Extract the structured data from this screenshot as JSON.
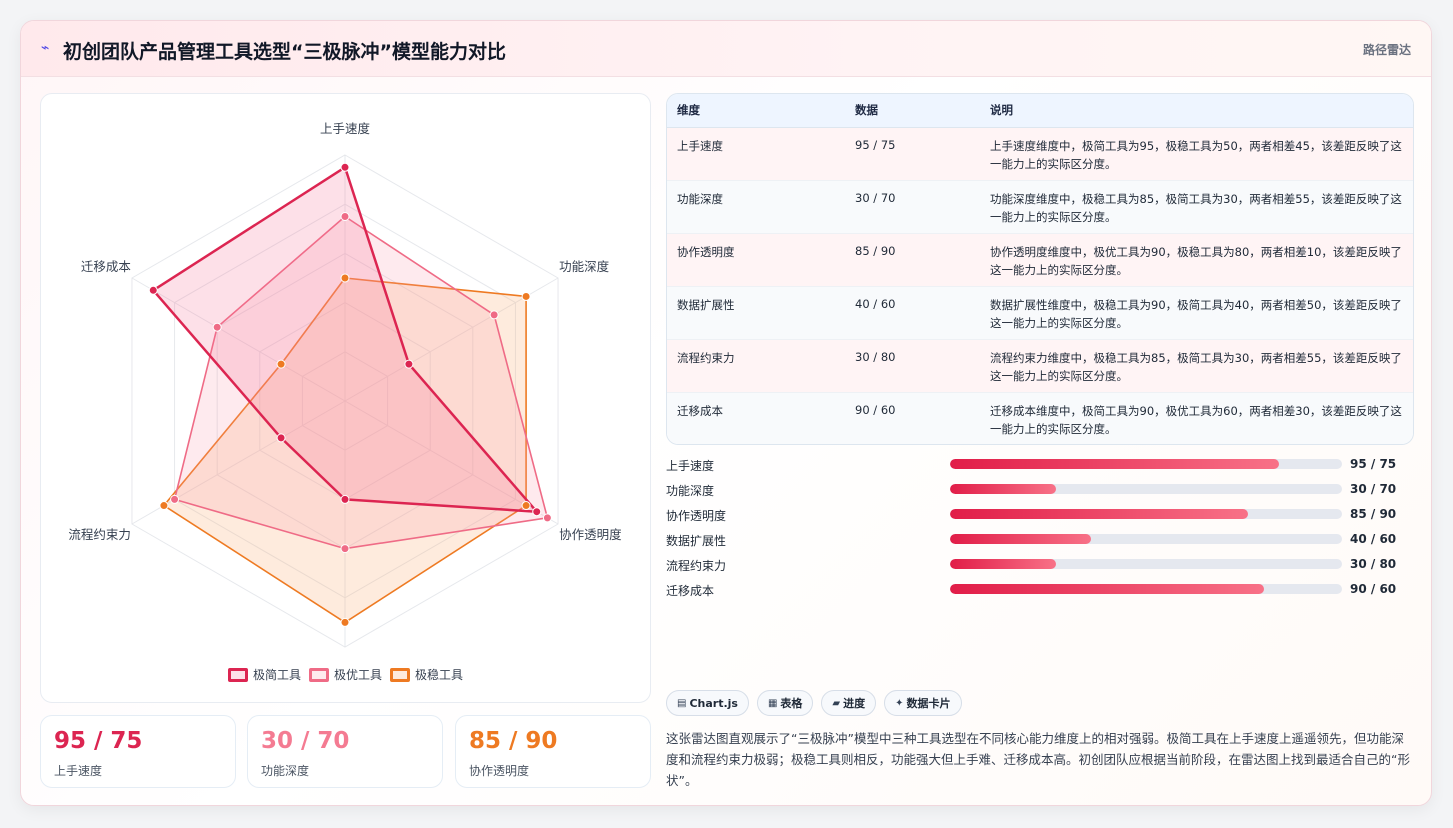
{
  "header": {
    "icon": "lightning-icon",
    "title": "初创团队产品管理工具选型“三极脉冲”模型能力对比",
    "right_label": "路径雷达"
  },
  "chart_data": {
    "type": "radar",
    "axes": [
      "上手速度",
      "功能深度",
      "协作透明度",
      "数据扩展性",
      "流程约束力",
      "迁移成本"
    ],
    "rmax": 100,
    "ring_levels": 5,
    "series": [
      {
        "name": "极简工具",
        "values": [
          95,
          30,
          90,
          40,
          30,
          90
        ],
        "color": "#dc2551",
        "fill": "rgba(244, 114, 150, 0.22)",
        "stroke_width": 2.5
      },
      {
        "name": "极优工具",
        "values": [
          75,
          70,
          95,
          60,
          80,
          60
        ],
        "color": "#ef6b86",
        "fill": "rgba(248, 150, 170, 0.20)",
        "stroke_width": 1.6
      },
      {
        "name": "极稳工具",
        "values": [
          50,
          85,
          85,
          90,
          85,
          30
        ],
        "color": "#ee7a22",
        "fill": "rgba(251, 176, 120, 0.25)",
        "stroke_width": 1.6
      }
    ]
  },
  "stats": [
    {
      "value": "95 / 75",
      "label": "上手速度",
      "color": "#dc2551"
    },
    {
      "value": "30 / 70",
      "label": "功能深度",
      "color": "#f47b92"
    },
    {
      "value": "85 / 90",
      "label": "协作透明度",
      "color": "#ee7a22"
    }
  ],
  "table": {
    "headers": [
      "维度",
      "数据",
      "说明"
    ],
    "rows": [
      {
        "dim": "上手速度",
        "data": "95 / 75",
        "desc": "上手速度维度中，极简工具为95，极稳工具为50，两者相差45，该差距反映了这一能力上的实际区分度。"
      },
      {
        "dim": "功能深度",
        "data": "30 / 70",
        "desc": "功能深度维度中，极稳工具为85，极简工具为30，两者相差55，该差距反映了这一能力上的实际区分度。"
      },
      {
        "dim": "协作透明度",
        "data": "85 / 90",
        "desc": "协作透明度维度中，极优工具为90，极稳工具为80，两者相差10，该差距反映了这一能力上的实际区分度。"
      },
      {
        "dim": "数据扩展性",
        "data": "40 / 60",
        "desc": "数据扩展性维度中，极稳工具为90，极简工具为40，两者相差50，该差距反映了这一能力上的实际区分度。"
      },
      {
        "dim": "流程约束力",
        "data": "30 / 80",
        "desc": "流程约束力维度中，极稳工具为85，极简工具为30，两者相差55，该差距反映了这一能力上的实际区分度。"
      },
      {
        "dim": "迁移成本",
        "data": "90 / 60",
        "desc": "迁移成本维度中，极简工具为90，极优工具为60，两者相差30，该差距反映了这一能力上的实际区分度。"
      }
    ]
  },
  "bars": [
    {
      "label": "上手速度",
      "value": "95 / 75",
      "fraction": 0.84
    },
    {
      "label": "功能深度",
      "value": "30 / 70",
      "fraction": 0.27
    },
    {
      "label": "协作透明度",
      "value": "85 / 90",
      "fraction": 0.76
    },
    {
      "label": "数据扩展性",
      "value": "40 / 60",
      "fraction": 0.36
    },
    {
      "label": "流程约束力",
      "value": "30 / 80",
      "fraction": 0.27
    },
    {
      "label": "迁移成本",
      "value": "90 / 60",
      "fraction": 0.8
    }
  ],
  "tags": [
    {
      "icon": "chart-icon",
      "glyph": "▤",
      "label": "Chart.js"
    },
    {
      "icon": "table-icon",
      "glyph": "▦",
      "label": "表格"
    },
    {
      "icon": "progress-icon",
      "glyph": "▰",
      "label": "进度"
    },
    {
      "icon": "card-icon",
      "glyph": "✦",
      "label": "数据卡片"
    }
  ],
  "summary": "这张雷达图直观展示了“三极脉冲”模型中三种工具选型在不同核心能力维度上的相对强弱。极简工具在上手速度上遥遥领先，但功能深度和流程约束力极弱；极稳工具则相反，功能强大但上手难、迁移成本高。初创团队应根据当前阶段，在雷达图上找到最适合自己的“形状”。"
}
